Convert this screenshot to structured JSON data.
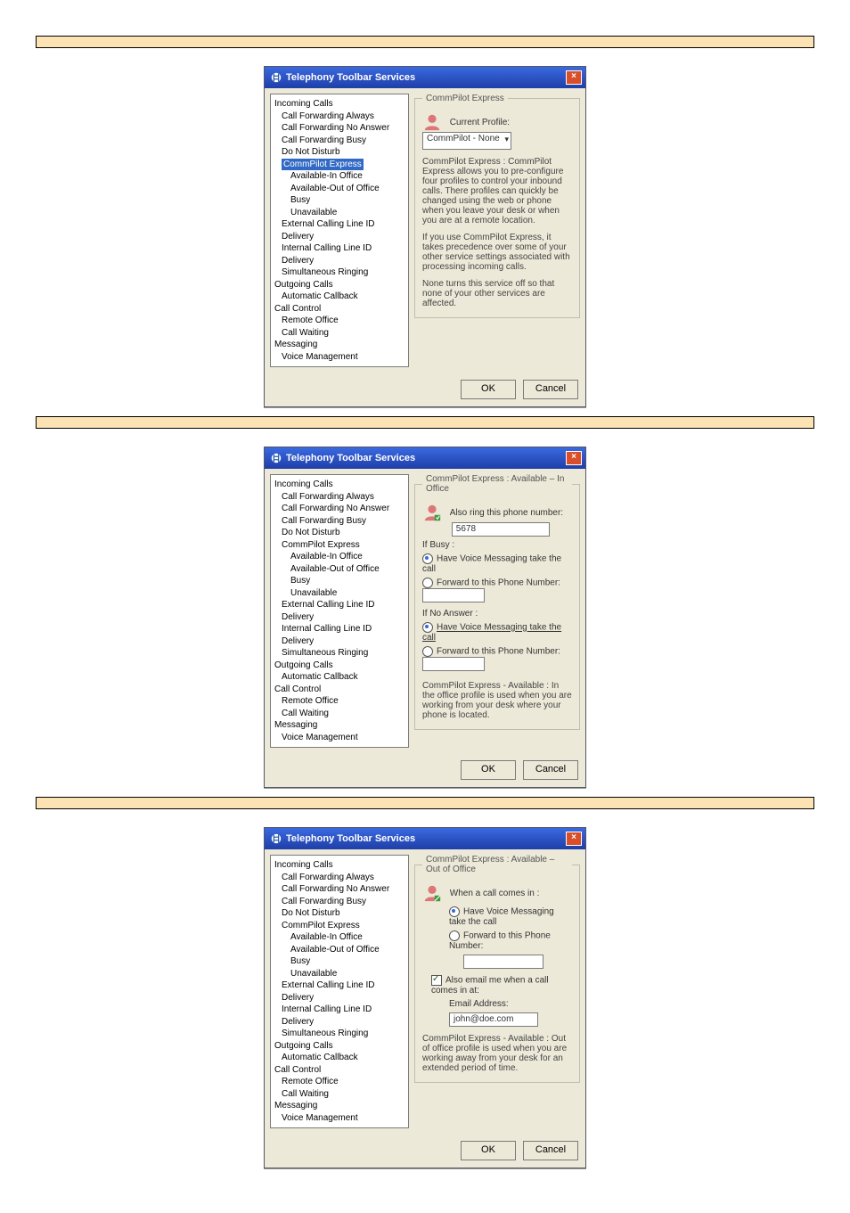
{
  "captions": {
    "c1": " ",
    "c2": " ",
    "c3": " "
  },
  "dialog1": {
    "title": "Telephony Toolbar Services",
    "tree": {
      "incoming_calls": "Incoming Calls",
      "cfa": "Call Forwarding Always",
      "cfna": "Call Forwarding No Answer",
      "cfb": "Call Forwarding Busy",
      "dnd": "Do Not Disturb",
      "cpe": "CommPilot Express",
      "avin": "Available-In Office",
      "avout": "Available-Out of Office",
      "busy": "Busy",
      "unavail": "Unavailable",
      "eclid": "External Calling Line ID Delivery",
      "iclid": "Internal Calling Line ID Delivery",
      "sim": "Simultaneous Ringing",
      "outgoing": "Outgoing Calls",
      "acb": "Automatic Callback",
      "cc": "Call Control",
      "remote": "Remote Office",
      "cw": "Call Waiting",
      "msg": "Messaging",
      "vm": "Voice Management"
    },
    "panel": {
      "legend": "CommPilot Express",
      "current_profile_label": "Current Profile:",
      "current_profile_value": "CommPilot - None",
      "p1": "CommPilot Express : CommPilot Express allows you to pre-configure four profiles to control your inbound calls. There profiles can quickly be changed using the web or phone when you leave your desk or when you are at a remote location.",
      "p2": "If you use CommPilot Express, it takes precedence over some of your other service settings associated with processing incoming calls.",
      "p3": "None turns this service off so that none of your other services are affected."
    },
    "ok": "OK",
    "cancel": "Cancel"
  },
  "dialog2": {
    "title": "Telephony Toolbar Services",
    "panel": {
      "legend": "CommPilot Express : Available – In Office",
      "also_ring": "Also ring this phone number:",
      "also_ring_value": "5678",
      "if_busy": "If Busy :",
      "r1": "Have Voice Messaging take the call",
      "r2": "Forward to this Phone Number:",
      "if_noanswer": "If No Answer :",
      "r3": "Have Voice Messaging take the call",
      "r4": "Forward to this Phone Number:",
      "note": "CommPilot Express - Available : In the office profile is used when you are working from your desk where your phone is located."
    },
    "ok": "OK",
    "cancel": "Cancel"
  },
  "dialog3": {
    "title": "Telephony Toolbar Services",
    "panel": {
      "legend": "CommPilot Express : Available – Out of Office",
      "when_call": "When a call comes in :",
      "r1": "Have Voice Messaging take the call",
      "r2": "Forward to this Phone Number:",
      "chk": "Also email me when a call comes in at:",
      "email_label": "Email Address:",
      "email_value": "john@doe.com",
      "note": "CommPilot Express - Available : Out of office profile is used when you are working away from your desk for an extended period of time."
    },
    "ok": "OK",
    "cancel": "Cancel"
  }
}
